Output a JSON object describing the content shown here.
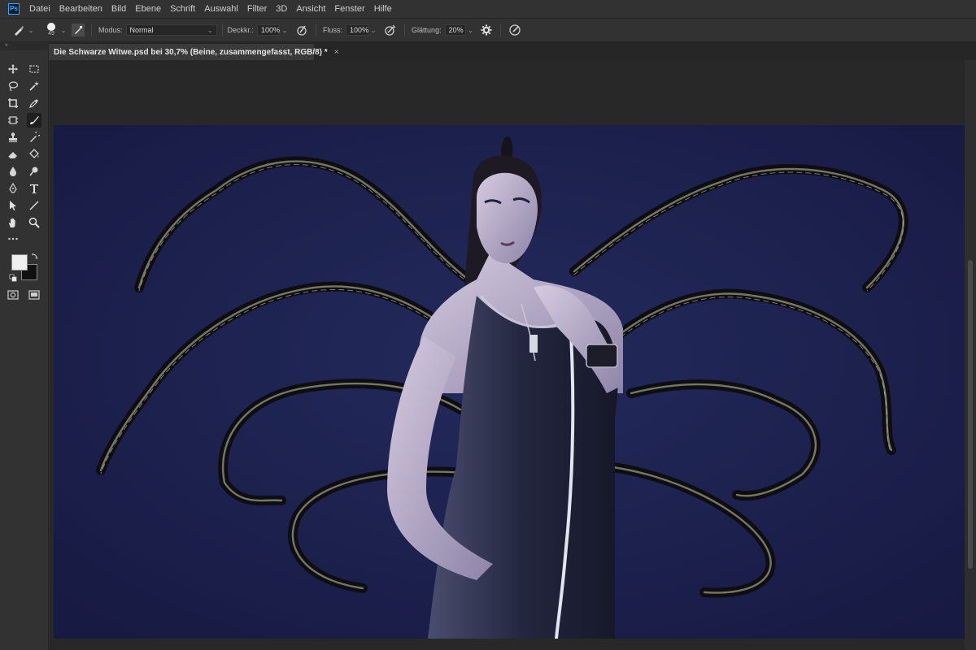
{
  "app": {
    "logo": "Ps",
    "menu": [
      "Datei",
      "Bearbeiten",
      "Bild",
      "Ebene",
      "Schrift",
      "Auswahl",
      "Filter",
      "3D",
      "Ansicht",
      "Fenster",
      "Hilfe"
    ]
  },
  "options": {
    "brush_size": "49",
    "mode_label": "Modus:",
    "mode_value": "Normal",
    "opacity_label": "Deckkr.:",
    "opacity_value": "100%",
    "flow_label": "Fluss:",
    "flow_value": "100%",
    "smoothing_label": "Glättung:",
    "smoothing_value": "20%"
  },
  "document": {
    "tab_title": "Die Schwarze Witwe.psd bei 30,7% (Beine, zusammengefasst, RGB/8) *",
    "close_glyph": "×"
  },
  "colors": {
    "ui_dark": "#323232",
    "canvas_bg": "#1a1e48",
    "foreground_swatch": "#f0f0f0",
    "background_swatch": "#111111",
    "ps_blue": "#31a8ff"
  },
  "tools": [
    "move-tool",
    "marquee-tool",
    "lasso-tool",
    "magic-wand-tool",
    "crop-tool",
    "eyedropper-tool",
    "frame-tool",
    "brush-tool",
    "stamp-tool",
    "history-brush-tool",
    "eraser-tool",
    "paint-bucket-tool",
    "blur-tool",
    "dodge-tool",
    "pen-tool",
    "type-tool",
    "path-selection-tool",
    "line-tool",
    "hand-tool",
    "zoom-tool"
  ]
}
